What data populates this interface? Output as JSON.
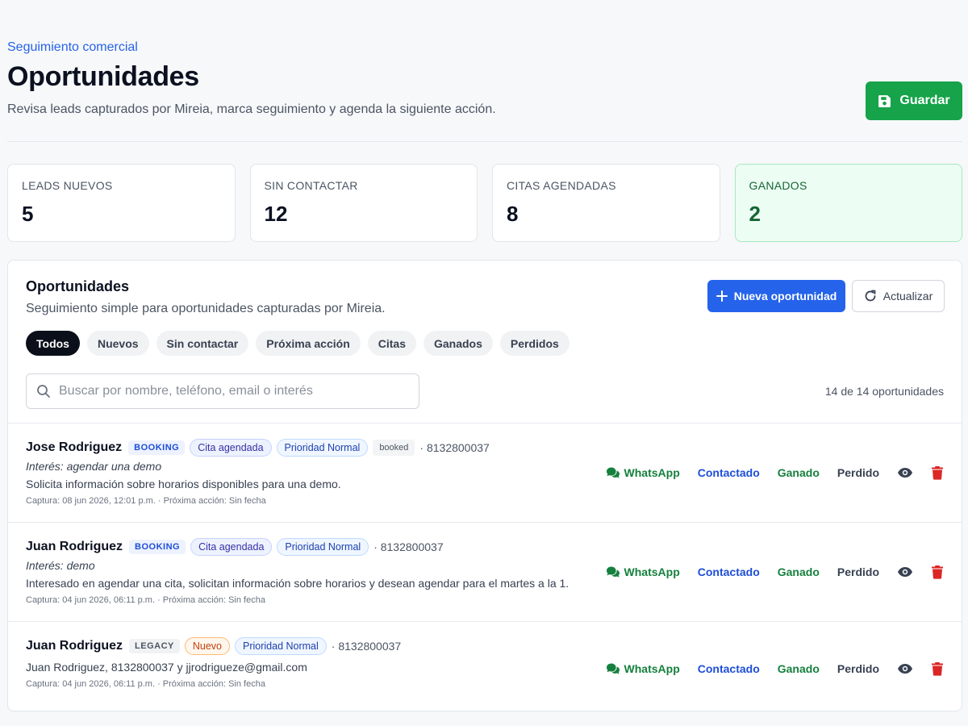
{
  "header": {
    "eyebrow": "Seguimiento comercial",
    "title": "Oportunidades",
    "subtitle": "Revisa leads capturados por Mireia, marca seguimiento y agenda la siguiente acción.",
    "save_label": "Guardar"
  },
  "stats": [
    {
      "label": "LEADS NUEVOS",
      "value": "5"
    },
    {
      "label": "SIN CONTACTAR",
      "value": "12"
    },
    {
      "label": "CITAS AGENDADAS",
      "value": "8"
    },
    {
      "label": "GANADOS",
      "value": "2"
    }
  ],
  "panel": {
    "title": "Oportunidades",
    "subtitle": "Seguimiento simple para oportunidades capturadas por Mireia.",
    "new_label": "Nueva oportunidad",
    "refresh_label": "Actualizar",
    "filters": [
      "Todos",
      "Nuevos",
      "Sin contactar",
      "Próxima acción",
      "Citas",
      "Ganados",
      "Perdidos"
    ],
    "active_filter": "Todos",
    "search_placeholder": "Buscar por nombre, teléfono, email o interés",
    "count": "14 de 14 oportunidades"
  },
  "actions": {
    "whatsapp": "WhatsApp",
    "contacted": "Contactado",
    "won": "Ganado",
    "lost": "Perdido"
  },
  "colors": {
    "primary": "#2563eb",
    "success": "#16a34a",
    "danger": "#dc2626",
    "dark": "#0b0f19"
  },
  "rows": [
    {
      "name": "Jose Rodriguez",
      "source": "BOOKING",
      "pill1": "Cita agendada",
      "pill2": "Prioridad Normal",
      "status": "booked",
      "phone": "· 8132800037",
      "interest": "Interés: agendar una demo",
      "desc": "Solicita información sobre horarios disponibles para una demo.",
      "meta": "Captura: 08 jun 2026, 12:01 p.m. · Próxima acción: Sin fecha"
    },
    {
      "name": "Juan Rodriguez",
      "source": "BOOKING",
      "pill1": "Cita agendada",
      "pill2": "Prioridad Normal",
      "phone": "· 8132800037",
      "interest": "Interés: demo",
      "desc": "Interesado en agendar una cita, solicitan información sobre horarios y desean agendar para el martes a la 1.",
      "meta": "Captura: 04 jun 2026, 06:11 p.m. · Próxima acción: Sin fecha"
    },
    {
      "name": "Juan Rodriguez",
      "source": "LEGACY",
      "pill1": "Nuevo",
      "pill2": "Prioridad Normal",
      "phone": "· 8132800037",
      "desc": "Juan Rodriguez, 8132800037 y jjrodrigueze@gmail.com",
      "meta": "Captura: 04 jun 2026, 06:11 p.m. · Próxima acción: Sin fecha"
    }
  ]
}
